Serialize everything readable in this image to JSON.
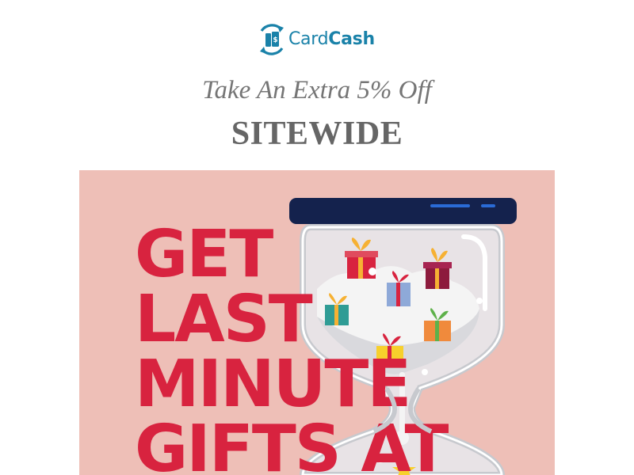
{
  "brand": {
    "name_part1": "Card",
    "name_part2": "Cash",
    "color": "#1a82a9",
    "icon": "cardcash-logo-icon"
  },
  "offer": {
    "subhead": "Take An Extra 5% Off",
    "headline": "SITEWIDE"
  },
  "banner": {
    "background": "#eebfb7",
    "text_color": "#d8233f",
    "lines": [
      "GET",
      "LAST",
      "MINUTE",
      "GIFTS AT"
    ],
    "illustration": "hourglass-gifts-icon"
  }
}
